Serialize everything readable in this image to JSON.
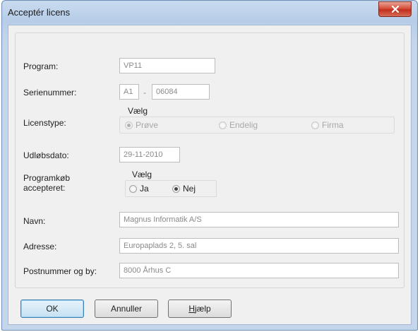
{
  "window": {
    "title": "Acceptér licens"
  },
  "fields": {
    "program": {
      "label": "Program:",
      "value": "VP11"
    },
    "serienummer": {
      "label": "Serienummer:",
      "part1": "A1",
      "separator": "-",
      "part2": "06084"
    },
    "licenstype": {
      "label": "Licenstype:",
      "heading": "Vælg",
      "options": [
        "Prøve",
        "Endelig",
        "Firma"
      ],
      "selected": "Prøve"
    },
    "udlobsdato": {
      "label": "Udløbsdato:",
      "value": "29-11-2010"
    },
    "programkob": {
      "label_line1": "Programkøb",
      "label_line2": "accepteret:",
      "heading": "Vælg",
      "options": [
        "Ja",
        "Nej"
      ],
      "selected": "Nej"
    },
    "navn": {
      "label": "Navn:",
      "value": "Magnus Informatik A/S"
    },
    "adresse": {
      "label": "Adresse:",
      "value": "Europaplads 2, 5. sal"
    },
    "postnummer": {
      "label": "Postnummer og by:",
      "value": "8000 Århus C"
    }
  },
  "buttons": {
    "ok": "OK",
    "annuller": "Annuller",
    "hjaelp_first": "H",
    "hjaelp_rest": "jælp"
  },
  "colors": {
    "title_bar": "#b7cde8",
    "close_button": "#c0301c",
    "default_button": "#c6e1f3"
  }
}
